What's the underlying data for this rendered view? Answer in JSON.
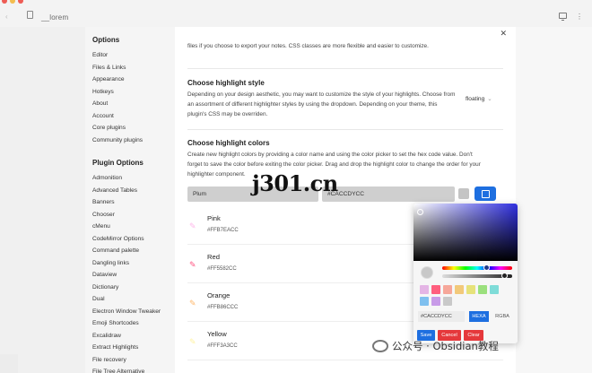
{
  "tab": {
    "title": "__lorem"
  },
  "sidebar": {
    "options_heading": "Options",
    "options": [
      "Editor",
      "Files & Links",
      "Appearance",
      "Hotkeys",
      "About",
      "Account",
      "Core plugins",
      "Community plugins"
    ],
    "plugin_heading": "Plugin Options",
    "plugins": [
      "Admonition",
      "Advanced Tables",
      "Banners",
      "Chooser",
      "cMenu",
      "CodeMirror Options",
      "Command palette",
      "Dangling links",
      "Dataview",
      "Dictionary",
      "Dual",
      "Electron Window Tweaker",
      "Emoji Shortcodes",
      "Excalidraw",
      "Extract Highlights",
      "File recovery",
      "File Tree Alternative"
    ]
  },
  "content": {
    "intro_text": "files if you choose to export your notes. CSS classes are more flexible and easier to customize.",
    "style_section": {
      "title": "Choose highlight style",
      "desc": "Depending on your design aesthetic, you may want to customize the style of your highlights. Choose from an assortment of different highlighter styles by using the dropdown. Depending on your theme, this plugin's CSS may be overriden.",
      "dropdown_value": "floating"
    },
    "colors_section": {
      "title": "Choose highlight colors",
      "desc": "Create new highlight colors by providing a color name and using the color picker to set the hex code value. Don't forget to save the color before exiting the color picker. Drag and drop the highlight color to change the order for your highlighter component."
    },
    "name_input": "Plum",
    "hex_input": "#CACCDYCC",
    "highlights": [
      {
        "name": "Pink",
        "hex": "#FFB7EACC",
        "color": "#FFB7EA"
      },
      {
        "name": "Red",
        "hex": "#FF5582CC",
        "color": "#FF5582"
      },
      {
        "name": "Orange",
        "hex": "#FFB86CCC",
        "color": "#FFB86C"
      },
      {
        "name": "Yellow",
        "hex": "#FFF3A3CC",
        "color": "#FFF3A3"
      }
    ]
  },
  "picker": {
    "hex_value": "#CACCDYCC",
    "mode_hexa": "HEXA",
    "mode_rgba": "RGBA",
    "save_label": "Save",
    "cancel_label": "Cancel",
    "clear_label": "Clear",
    "swatches": [
      "#e4b5e5",
      "#ff5f7e",
      "#f6a79a",
      "#f2c97a",
      "#e6e27a",
      "#9be07d",
      "#7fdcd8",
      "#7fc0ef",
      "#c89be8",
      "#c9c9c9"
    ]
  },
  "overlays": {
    "site_watermark": "j301.cn",
    "wechat_text": "公众号 · Obsidian教程"
  }
}
